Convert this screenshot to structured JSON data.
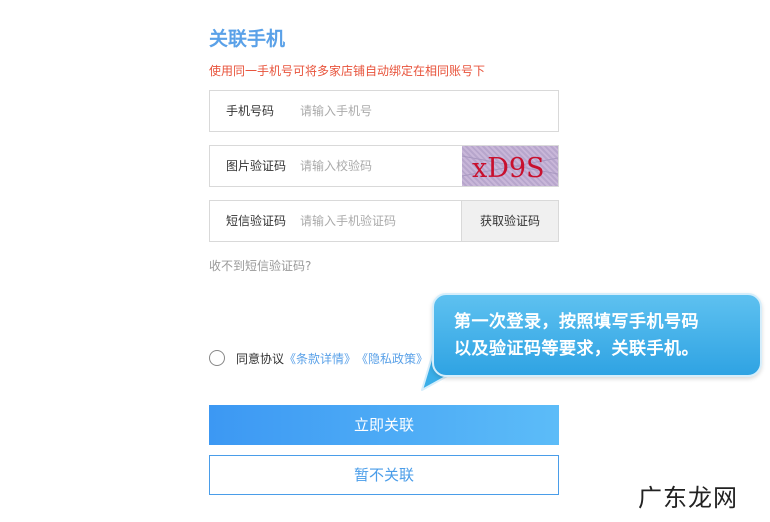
{
  "header": {
    "title": "关联手机",
    "notice": "使用同一手机号可将多家店铺自动绑定在相同账号下"
  },
  "form": {
    "phone": {
      "label": "手机号码",
      "placeholder": "请输入手机号",
      "value": ""
    },
    "captcha": {
      "label": "图片验证码",
      "placeholder": "请输入校验码",
      "value": "",
      "image_text": "xD9S"
    },
    "sms": {
      "label": "短信验证码",
      "placeholder": "请输入手机验证码",
      "value": "",
      "button_label": "获取验证码"
    },
    "no_sms_link": "收不到短信验证码?",
    "agreement": {
      "prefix": "同意协议",
      "terms_link": "《条款详情》",
      "privacy_link": "《隐私政策》",
      "checked": false
    }
  },
  "tooltip": {
    "line1": "第一次登录，按照填写手机号码",
    "line2": "以及验证码等要求，关联手机。"
  },
  "actions": {
    "confirm_label": "立即关联",
    "skip_label": "暂不关联"
  },
  "watermark": "广东龙网",
  "colors": {
    "accent": "#5aa1e8",
    "notice": "#e8533b",
    "bubble": "#3aaee8",
    "captcha_text": "#c8102e"
  }
}
